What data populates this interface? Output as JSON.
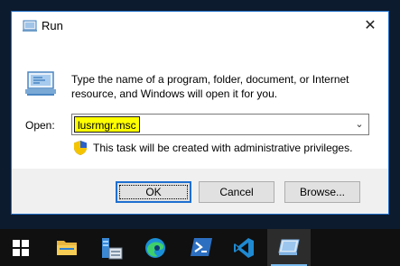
{
  "window": {
    "title": "Run",
    "close_glyph": "✕",
    "description": "Type the name of a program, folder, document, or Internet resource, and Windows will open it for you.",
    "open_label": "Open:",
    "open_value": "lusrmgr.msc",
    "dropdown_glyph": "⌄",
    "admin_notice": "This task will be created with administrative privileges.",
    "buttons": {
      "ok": "OK",
      "cancel": "Cancel",
      "browse": "Browse..."
    }
  },
  "taskbar": {
    "items": [
      {
        "name": "start-button",
        "icon": "windows-logo-icon"
      },
      {
        "name": "file-explorer",
        "icon": "folder-icon"
      },
      {
        "name": "server-manager",
        "icon": "server-manager-icon"
      },
      {
        "name": "edge",
        "icon": "edge-icon"
      },
      {
        "name": "powershell",
        "icon": "powershell-icon"
      },
      {
        "name": "vscode",
        "icon": "vscode-icon"
      },
      {
        "name": "run",
        "icon": "run-icon",
        "active": true
      }
    ]
  },
  "colors": {
    "accent": "#1e6fd0",
    "highlight": "#ffff00",
    "taskbar": "#101010",
    "desktop": "#0d1b2e"
  }
}
